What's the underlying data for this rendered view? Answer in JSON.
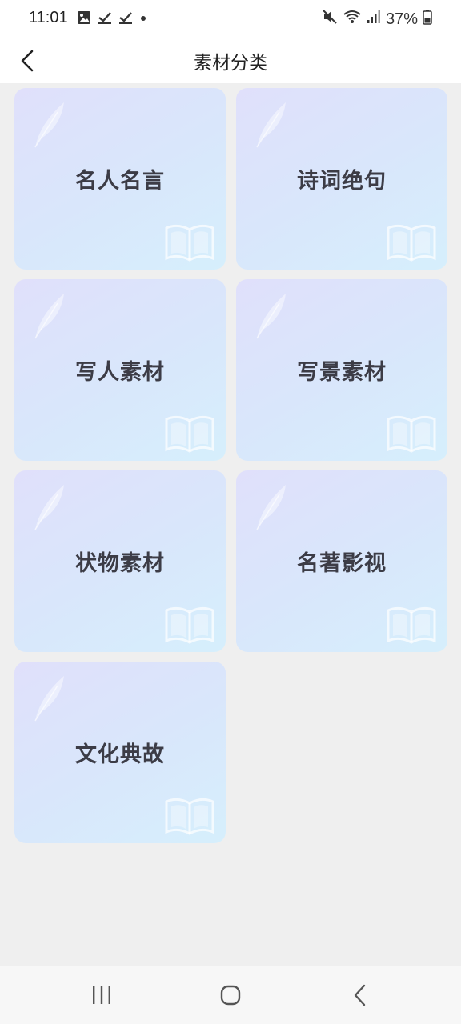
{
  "status_bar": {
    "time": "11:01",
    "battery": "37%",
    "icons": [
      "image-icon",
      "check-download-icon",
      "check-download-icon",
      "dot-icon",
      "mute-icon",
      "wifi-icon",
      "signal-icon",
      "battery-icon"
    ]
  },
  "header": {
    "title": "素材分类",
    "back_icon": "back-chevron-icon"
  },
  "categories": [
    {
      "label": "名人名言"
    },
    {
      "label": "诗词绝句"
    },
    {
      "label": "写人素材"
    },
    {
      "label": "写景素材"
    },
    {
      "label": "状物素材"
    },
    {
      "label": "名著影视"
    },
    {
      "label": "文化典故"
    }
  ],
  "bottom_nav": {
    "icons": [
      "recents-icon",
      "home-icon",
      "back-icon"
    ]
  },
  "colors": {
    "background": "#efefef",
    "card_gradient_start": "#e0e0fb",
    "card_gradient_end": "#d6effc",
    "label_text": "#3c3c46"
  }
}
